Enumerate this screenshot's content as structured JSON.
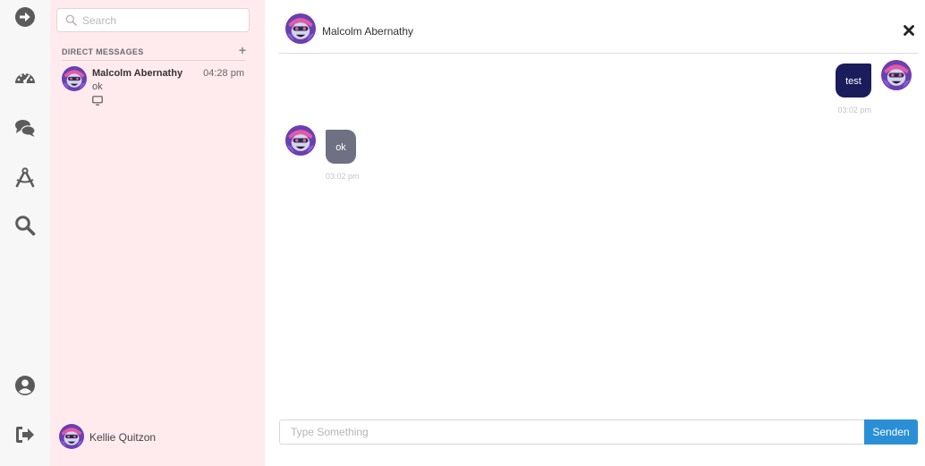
{
  "rail": {
    "icons": [
      "arrow-right-circle-icon",
      "dashboard-icon",
      "chat-bubbles-icon",
      "drafting-compass-icon",
      "search-icon",
      "user-circle-icon",
      "sign-out-icon"
    ]
  },
  "sidebar": {
    "search_placeholder": "Search",
    "dm_title": "DIRECT MESSAGES",
    "dm_add": "+",
    "conversations": [
      {
        "name": "Malcolm Abernathy",
        "time": "04:28 pm",
        "last_message": "ok",
        "device": "desktop-icon"
      }
    ],
    "current_user": "Kellie Quitzon"
  },
  "chat": {
    "contact_name": "Malcolm Abernathy",
    "messages": [
      {
        "direction": "outgoing",
        "text": "test",
        "time": "03:02 pm"
      },
      {
        "direction": "incoming",
        "text": "ok",
        "time": "03:02 pm"
      }
    ],
    "input_placeholder": "Type Something",
    "send_label": "Senden"
  },
  "colors": {
    "panel_bg": "#ffebee",
    "rail_bg": "#f7f7f7",
    "outgoing_bubble": "#1a1c5c",
    "incoming_bubble": "#6f7083",
    "send_button": "#2b8fd6"
  }
}
